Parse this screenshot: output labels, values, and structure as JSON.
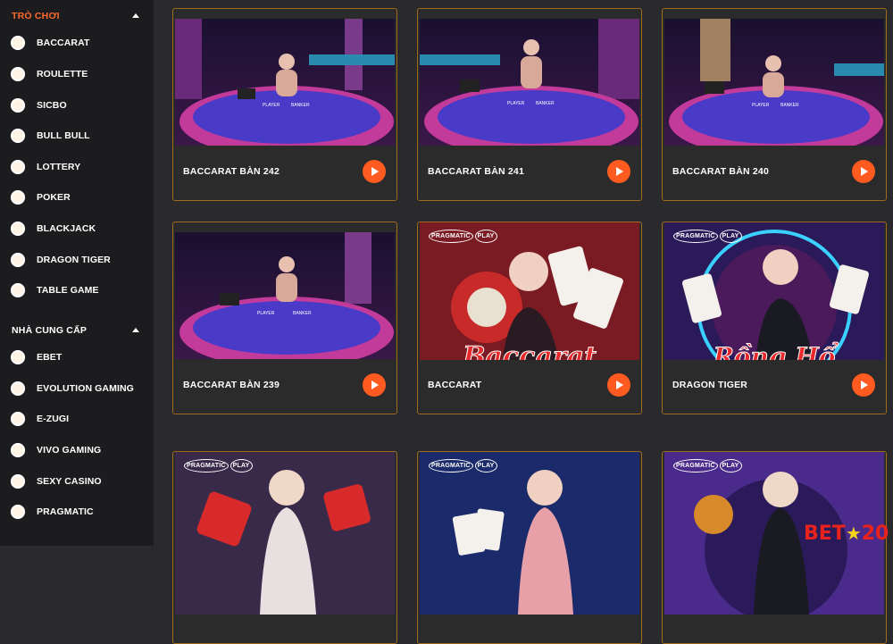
{
  "sidebar": {
    "games_heading": "TRÒ CHƠI",
    "games": [
      {
        "label": "BACCARAT"
      },
      {
        "label": "ROULETTE"
      },
      {
        "label": "SICBO"
      },
      {
        "label": "BULL BULL"
      },
      {
        "label": "LOTTERY"
      },
      {
        "label": "POKER"
      },
      {
        "label": "BLACKJACK"
      },
      {
        "label": "DRAGON TIGER"
      },
      {
        "label": "TABLE GAME"
      }
    ],
    "providers_heading": "NHÀ CUNG CẤP",
    "providers": [
      {
        "label": "EBET"
      },
      {
        "label": "EVOLUTION GAMING"
      },
      {
        "label": "E-ZUGI"
      },
      {
        "label": "VIVO GAMING"
      },
      {
        "label": "SEXY CASINO"
      },
      {
        "label": "PRAGMATIC"
      }
    ]
  },
  "cards": [
    {
      "title": "BACCARAT BÀN 242",
      "kind": "table"
    },
    {
      "title": "BACCARAT BÀN 241",
      "kind": "table"
    },
    {
      "title": "BACCARAT BÀN 240",
      "kind": "table"
    },
    {
      "title": "BACCARAT BÀN 239",
      "kind": "table"
    },
    {
      "title": "BACCARAT",
      "kind": "promo",
      "promo_text": "Baccarat"
    },
    {
      "title": "DRAGON TIGER",
      "kind": "promo",
      "promo_text": "Rồng Hổ"
    },
    {
      "title": "",
      "kind": "promo"
    },
    {
      "title": "",
      "kind": "promo"
    },
    {
      "title": "",
      "kind": "promo"
    }
  ],
  "table_labels": {
    "player": "PLAYER",
    "banker": "BANKER"
  },
  "provider_badge": {
    "text": "PRAGMATIC",
    "suffix": "PLAY"
  },
  "brand_logo": {
    "part1": "BET",
    "part2": "20"
  },
  "colors": {
    "accent": "#ff6a2b",
    "play_button": "#ff5a1f",
    "card_border": "#a06a1c"
  }
}
